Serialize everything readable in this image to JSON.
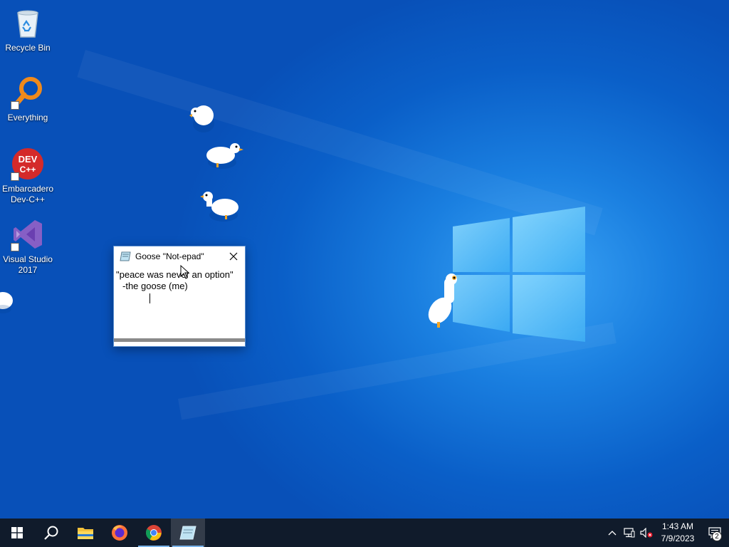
{
  "desktop": {
    "icons": [
      {
        "label": "Recycle Bin",
        "icon": "recycle-bin-icon"
      },
      {
        "label": "Everything",
        "icon": "everything-search-icon"
      },
      {
        "label": "Embarcadero Dev-C++",
        "icon": "devcpp-icon",
        "badge": "DEV C++"
      },
      {
        "label": "Visual Studio 2017",
        "icon": "visual-studio-icon"
      }
    ]
  },
  "notepad": {
    "title": "Goose \"Not-epad\"",
    "line1": "\"peace was never an option\"",
    "line2": "-the goose (me)"
  },
  "taskbar": {
    "apps": [
      "start-icon",
      "search-icon",
      "file-explorer-icon",
      "firefox-icon",
      "chrome-icon",
      "notepad-icon"
    ],
    "time": "1:43 AM",
    "date": "7/9/2023",
    "notification_count": "2"
  },
  "colors": {
    "desktop_dark": "#0850b8",
    "desktop_light": "#3aa3f5",
    "taskbar": "#101b2b",
    "logo": "#6ccbff"
  }
}
